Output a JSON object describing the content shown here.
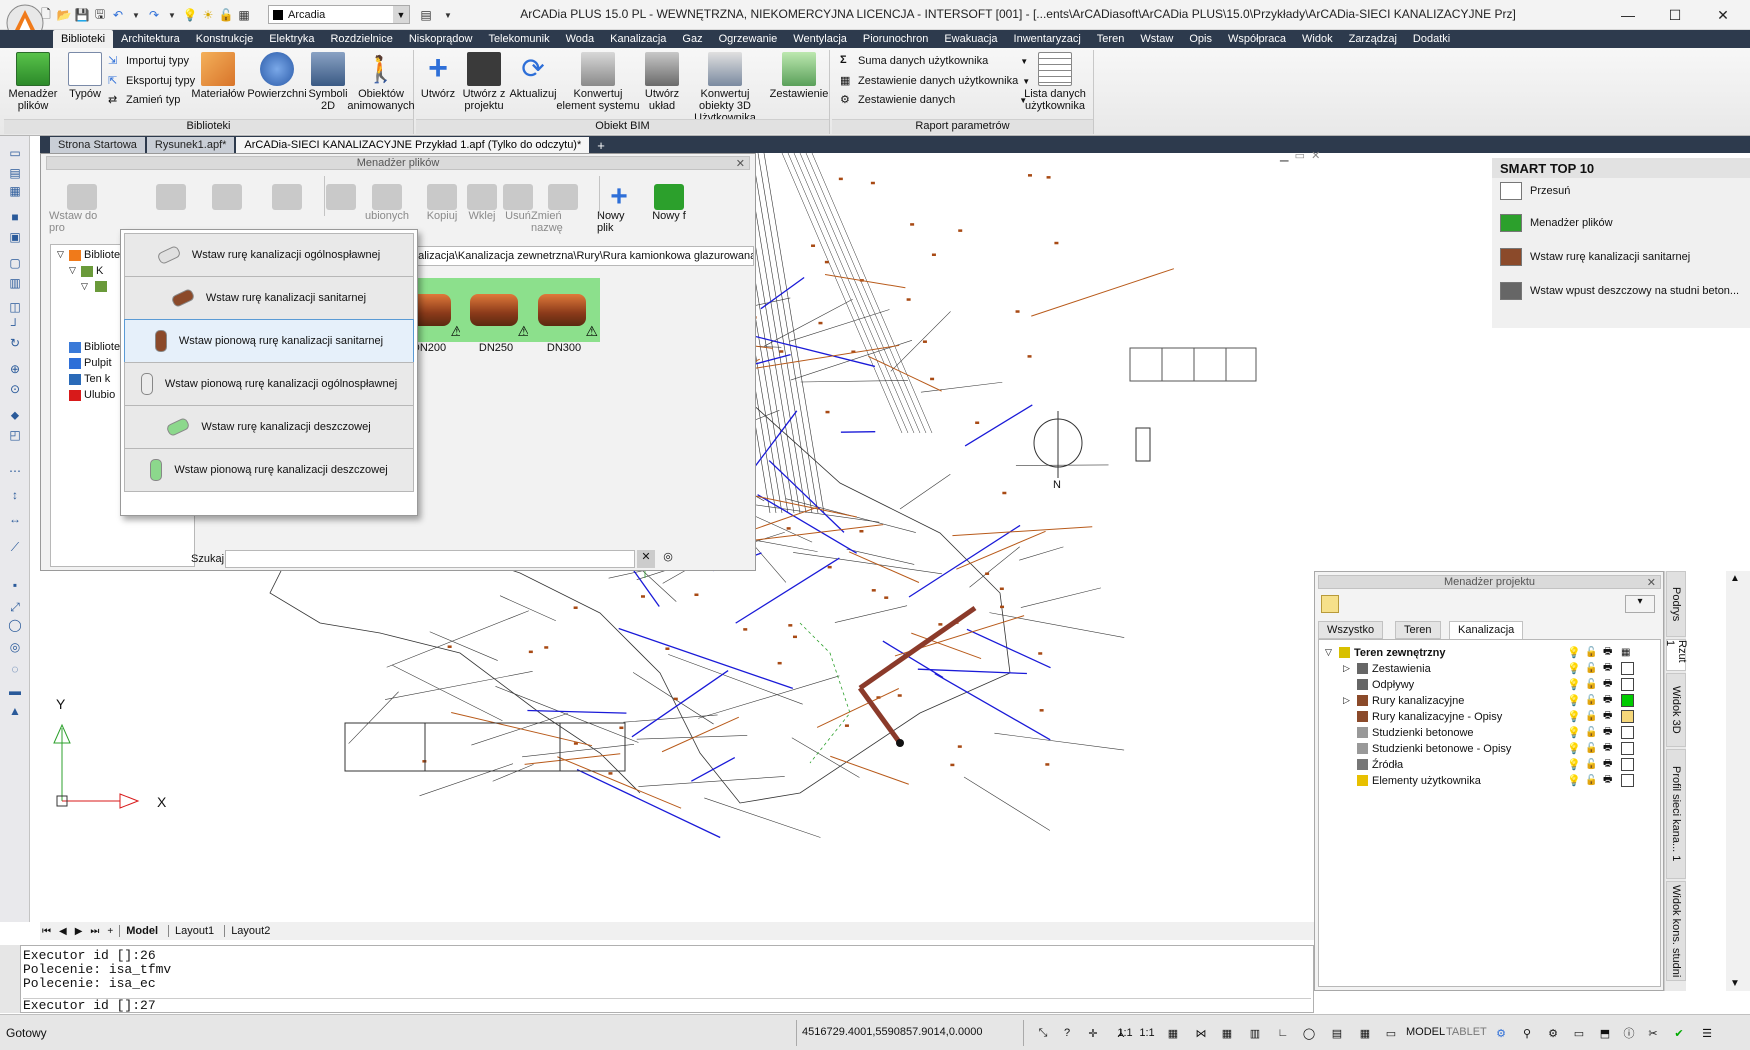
{
  "app": {
    "title": "ArCADia PLUS 15.0 PL - WEWNĘTRZNA, NIEKOMERCYJNA LICENCJA - INTERSOFT [001] - [...ents\\ArCADiasoft\\ArCADia PLUS\\15.0\\Przykłady\\ArCADia-SIECI KANALIZACYJNE Prz]",
    "layer_combo": "Arcadia",
    "minimize": "—",
    "maximize": "☐",
    "close": "✕"
  },
  "ribbon_tabs": [
    "Biblioteki",
    "Architektura",
    "Konstrukcje",
    "Elektryka",
    "Rozdzielnice",
    "Niskoprądow",
    "Telekomunik",
    "Woda",
    "Kanalizacja",
    "Gaz",
    "Ogrzewanie",
    "Wentylacja",
    "Piorunochron",
    "Ewakuacja",
    "Inwentaryzacj",
    "Teren",
    "Wstaw",
    "Opis",
    "Współpraca",
    "Widok",
    "Zarządzaj",
    "Dodatki"
  ],
  "ribbon": {
    "biblioteki": {
      "label": "Biblioteki",
      "menadzer": "Menadżer plików",
      "typow": "Typów",
      "importuj": "Importuj typy",
      "eksportuj": "Eksportuj typy",
      "zamien": "Zamień typ",
      "materialow": "Materiałów",
      "powierzchni": "Powierzchni",
      "symboli": "Symboli 2D",
      "obiektow": "Obiektów animowanych"
    },
    "bim": {
      "label": "Obiekt BIM",
      "utworz": "Utwórz",
      "utworz_z": "Utwórz z projektu",
      "aktualizuj": "Aktualizuj",
      "konwertuj": "Konwertuj element systemu",
      "utworz_uklad": "Utwórz układ",
      "konwertuj_3d": "Konwertuj obiekty 3D Użytkownika",
      "zestawienie": "Zestawienie"
    },
    "raport": {
      "label": "Raport parametrów",
      "suma": "Suma danych użytkownika",
      "zestawienie_danych_u": "Zestawienie danych użytkownika",
      "zestawienie_danych": "Zestawienie danych",
      "lista": "Lista danych użytkownika"
    }
  },
  "doc_tabs": [
    "Strona Startowa",
    "Rysunek1.apf*",
    "ArCADia-SIECI KANALIZACYJNE Przykład 1.apf (Tylko do odczytu)*"
  ],
  "doc_tab_add": "+",
  "file_manager": {
    "title": "Menadżer plików",
    "tools": [
      "Wstaw do pro",
      "",
      "",
      "",
      "",
      "ubionych",
      "Kopiuj",
      "Wklej",
      "Usuń",
      "Zmień nazwę",
      "Nowy plik",
      "Nowy f"
    ],
    "tree": [
      "Biblioteki",
      "K",
      "",
      "Biblioteki",
      "Pulpit",
      "Ten k",
      "Ulubio"
    ],
    "path": "nalizacja\\Kanalizacja zewnetrzna\\Rury\\Rura kamionkowa glazurowana",
    "thumbs": [
      "DN200",
      "DN250",
      "DN300"
    ],
    "search_label": "Szukaj:",
    "search_value": ""
  },
  "popup": {
    "items": [
      "Wstaw rurę kanalizacji ogólnospławnej",
      "Wstaw rurę kanalizacji sanitarnej",
      "Wstaw pionową rurę kanalizacji sanitarnej",
      "Wstaw pionową rurę kanalizacji ogólnospławnej",
      "Wstaw rurę kanalizacji deszczowej",
      "Wstaw pionową rurę kanalizacji deszczowej"
    ]
  },
  "smart_top": {
    "title": "SMART TOP 10",
    "items": [
      "Przesuń",
      "Menadżer plików",
      "Wstaw rurę kanalizacji sanitarnej",
      "Wstaw wpust deszczowy na studni beton..."
    ]
  },
  "project_manager": {
    "title": "Menadżer projektu",
    "tabs": [
      "Wszystko",
      "Teren",
      "Kanalizacja"
    ],
    "rows": [
      "Teren zewnętrzny",
      "Zestawienia",
      "Odpływy",
      "Rury kanalizacyjne",
      "Rury kanalizacyjne - Opisy",
      "Studzienki betonowe",
      "Studzienki betonowe - Opisy",
      "Źródła",
      "Elementy użytkownika"
    ]
  },
  "vertical_tabs": [
    "Podrys",
    "Rzut 1",
    "Widok 3D",
    "Profil sieci kana... 1",
    "Widok kons. studni"
  ],
  "layout_tabs": [
    "Model",
    "Layout1",
    "Layout2"
  ],
  "command_lines": [
    "Executor id []:26",
    "Polecenie: isa_tfmv",
    "Polecenie: isa_ec",
    "Executor id []:27"
  ],
  "drawing": {
    "north": "N",
    "ucs_x": "X",
    "ucs_y": "Y"
  },
  "status": {
    "text": "Gotowy",
    "coords": "4516729.4001,5590857.9014,0.0000",
    "scale": "1:1",
    "model": "MODEL",
    "tablet": "TABLET"
  },
  "colors": {
    "ribbon_tabs_bg": "#2d3a4d",
    "accent": "#2e6fd8",
    "pipe": "#8b3a1a",
    "selection": "#5b9bd5"
  }
}
